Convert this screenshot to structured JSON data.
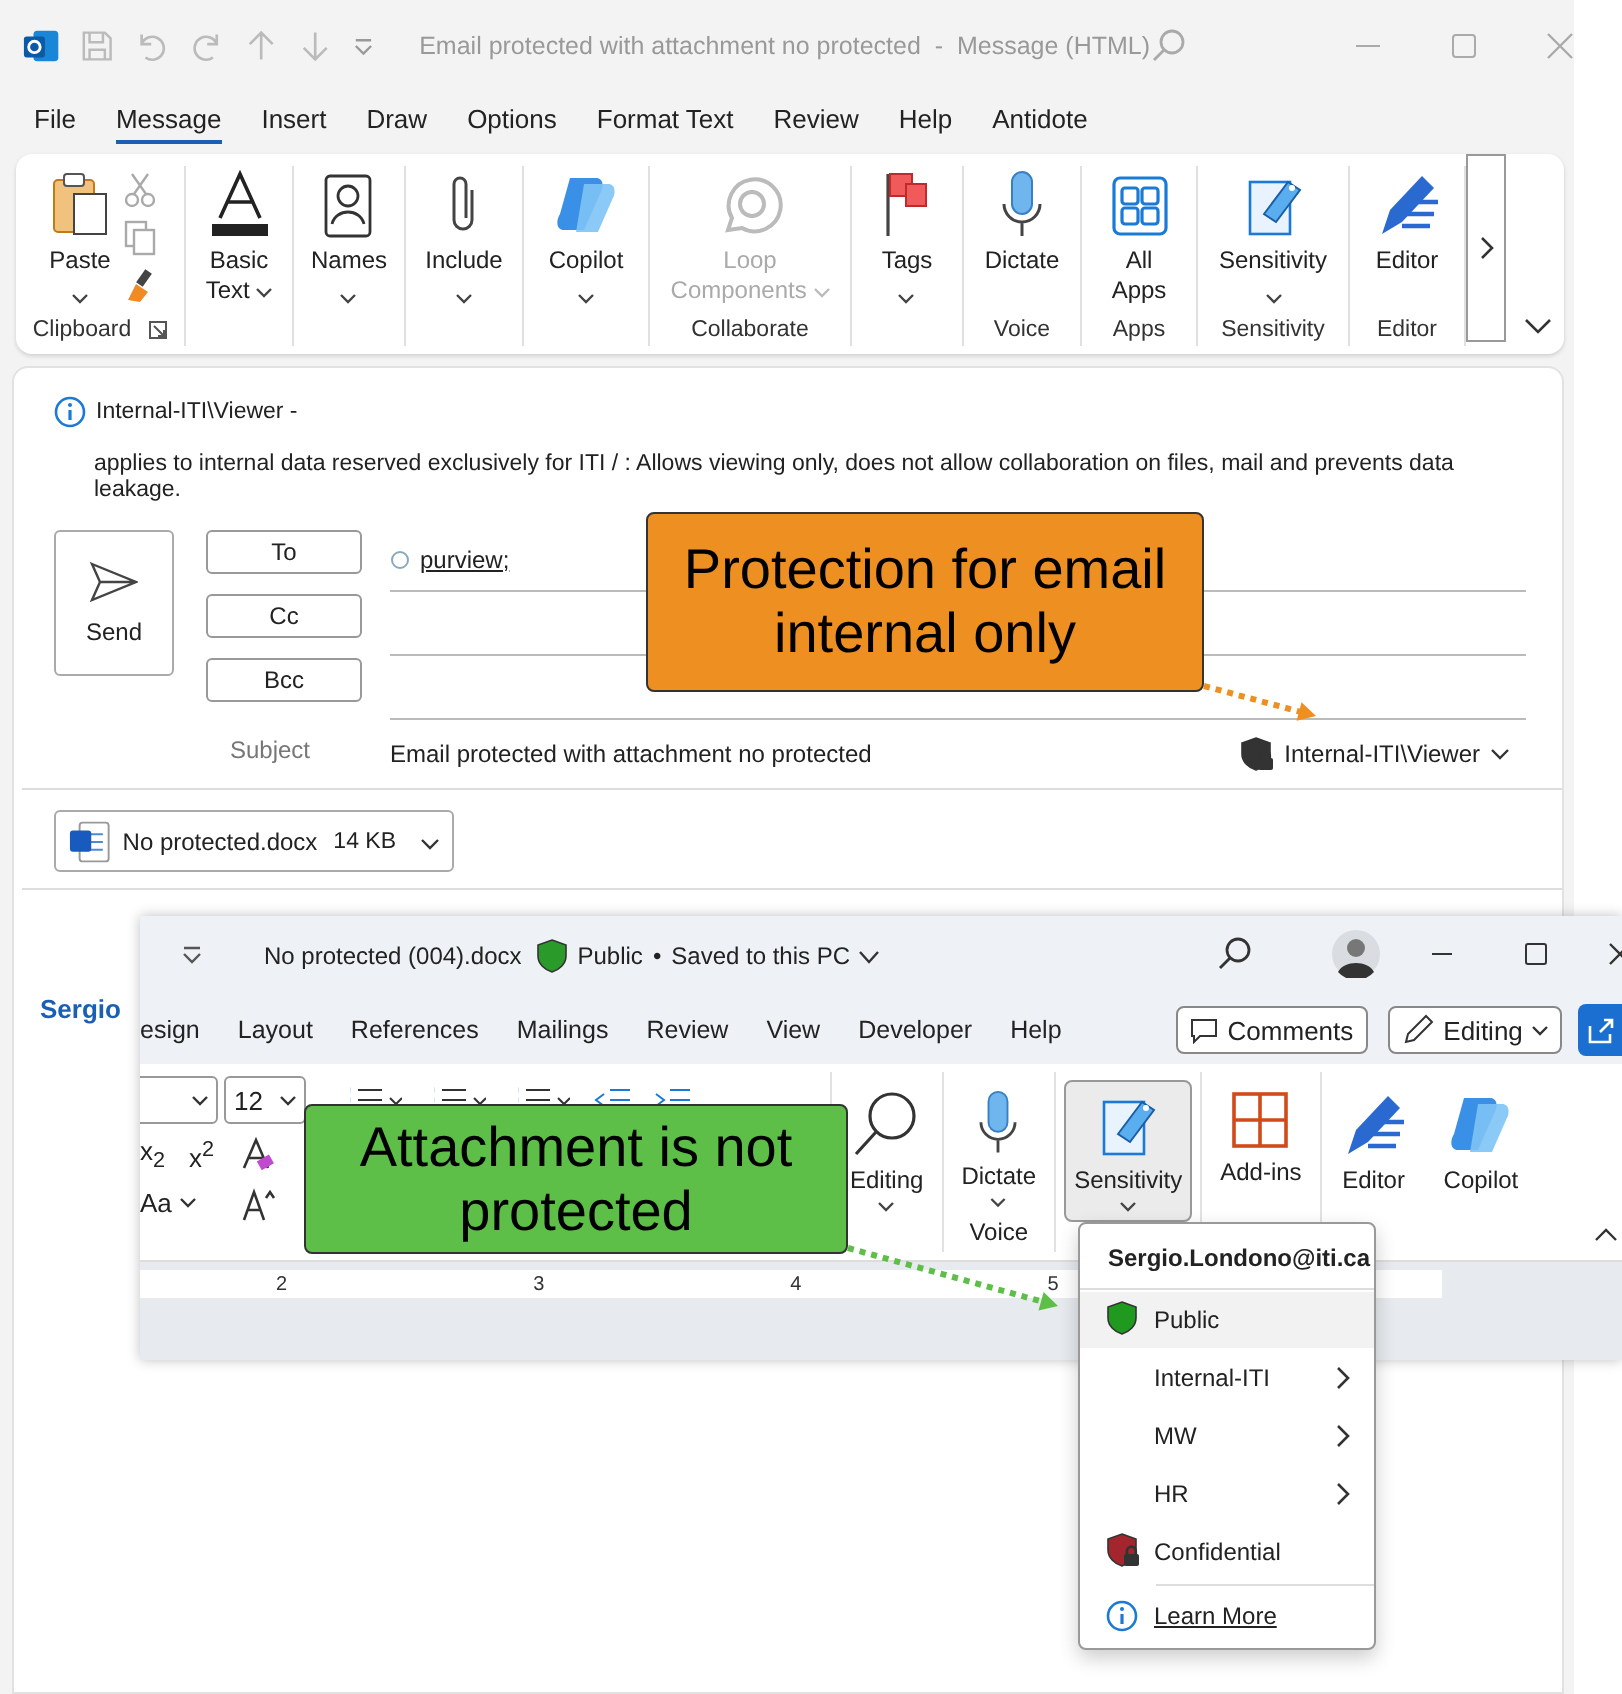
{
  "outlook": {
    "title": "Email protected with attachment no protected  -  Message (HTML)",
    "tabs": [
      {
        "label": "File",
        "selected": false
      },
      {
        "label": "Message",
        "selected": true
      },
      {
        "label": "Insert",
        "selected": false
      },
      {
        "label": "Draw",
        "selected": false
      },
      {
        "label": "Options",
        "selected": false
      },
      {
        "label": "Format Text",
        "selected": false
      },
      {
        "label": "Review",
        "selected": false
      },
      {
        "label": "Help",
        "selected": false
      },
      {
        "label": "Antidote",
        "selected": false
      }
    ],
    "ribbon": [
      {
        "group": "Clipboard",
        "buttons": [
          {
            "label": "Paste",
            "dropdown": true,
            "disabled": false
          }
        ]
      },
      {
        "buttons": [
          {
            "label": "Basic Text",
            "dropdown": true,
            "disabled": false
          }
        ]
      },
      {
        "buttons": [
          {
            "label": "Names",
            "dropdown": true,
            "disabled": false
          }
        ]
      },
      {
        "buttons": [
          {
            "label": "Include",
            "dropdown": true,
            "disabled": false
          }
        ]
      },
      {
        "buttons": [
          {
            "label": "Copilot",
            "dropdown": true,
            "disabled": false
          }
        ]
      },
      {
        "group": "Collaborate",
        "buttons": [
          {
            "label": "Loop Components",
            "dropdown": true,
            "disabled": true
          }
        ]
      },
      {
        "buttons": [
          {
            "label": "Tags",
            "dropdown": true,
            "disabled": false
          }
        ]
      },
      {
        "group": "Voice",
        "buttons": [
          {
            "label": "Dictate",
            "dropdown": false,
            "disabled": false
          }
        ]
      },
      {
        "group": "Apps",
        "buttons": [
          {
            "label": "All Apps",
            "dropdown": false,
            "disabled": false
          }
        ]
      },
      {
        "group": "Sensitivity",
        "buttons": [
          {
            "label": "Sensitivity",
            "dropdown": true,
            "disabled": false
          }
        ]
      },
      {
        "group": "Editor",
        "buttons": [
          {
            "label": "Editor",
            "dropdown": false,
            "disabled": false
          }
        ]
      }
    ],
    "message": {
      "info_title": "Internal-ITI\\Viewer -",
      "info_text": "applies to internal data reserved exclusively for ITI / : Allows viewing only, does not allow collaboration on files, mail and prevents data leakage.",
      "send": "Send",
      "recipient_buttons": [
        "To",
        "Cc",
        "Bcc"
      ],
      "to_value": "purview;",
      "subject_label": "Subject",
      "subject_value": "Email protected with attachment no protected",
      "sensitivity_label": "Internal-ITI\\Viewer",
      "attachment": {
        "name": "No protected.docx",
        "size": "14 KB"
      }
    },
    "body_text": "Sergio"
  },
  "word": {
    "file_name": "No protected (004).docx",
    "label": "Public",
    "separator": "•",
    "status": "Saved to this PC",
    "tabs": [
      "esign",
      "Layout",
      "References",
      "Mailings",
      "Review",
      "View",
      "Developer",
      "Help"
    ],
    "comments": "Comments",
    "editing_mode": "Editing",
    "font_size": "12",
    "subscript": "x$_{2}$",
    "superscript": "x$^{2}$",
    "change_case": "Aa",
    "ribbon": [
      {
        "label": "Editing",
        "dropdown": true,
        "selected": false
      },
      {
        "label": "Dictate",
        "group": "Voice",
        "dropdown": true,
        "selected": false
      },
      {
        "label": "Sensitivity",
        "dropdown": true,
        "selected": true
      },
      {
        "label": "Add-ins",
        "dropdown": false,
        "selected": false
      },
      {
        "label": "Editor",
        "dropdown": false,
        "selected": false
      },
      {
        "label": "Copilot",
        "dropdown": false,
        "selected": false
      }
    ],
    "ruler": [
      "2",
      "3",
      "4",
      "5"
    ],
    "menu": {
      "account": "Sergio.Londono@iti.ca",
      "items": [
        {
          "kind": "label",
          "label": "Public",
          "color": "#1f9a1f",
          "locked": false,
          "submenu": false,
          "selected": true
        },
        {
          "kind": "label",
          "label": "Internal-ITI",
          "submenu": true,
          "selected": false
        },
        {
          "kind": "label",
          "label": "MW",
          "submenu": true,
          "selected": false
        },
        {
          "kind": "label",
          "label": "HR",
          "submenu": true,
          "selected": false
        },
        {
          "kind": "label",
          "label": "Confidential",
          "color": "#a3262e",
          "locked": true,
          "submenu": false,
          "selected": false
        },
        {
          "kind": "link",
          "label": "Learn More"
        }
      ]
    }
  },
  "callouts": [
    {
      "text": "Protection for email internal only",
      "color": "#ee8f22"
    },
    {
      "text": "Attachment is not protected",
      "color": "#5dbf47"
    }
  ]
}
